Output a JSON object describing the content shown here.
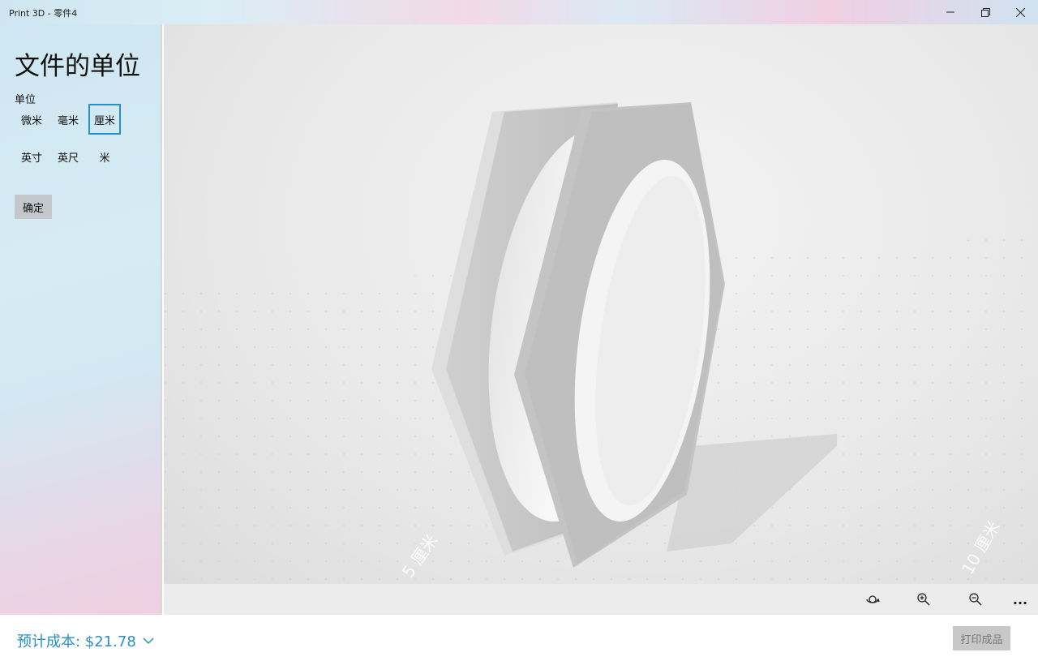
{
  "window": {
    "title": "Print 3D - 零件4",
    "minimize_icon": "minimize-icon",
    "maximize_icon": "restore-icon",
    "close_icon": "close-icon"
  },
  "panel": {
    "title": "文件的单位",
    "unit_label": "单位",
    "units": [
      {
        "label": "微米",
        "selected": false
      },
      {
        "label": "毫米",
        "selected": false
      },
      {
        "label": "厘米",
        "selected": true
      },
      {
        "label": "英寸",
        "selected": false
      },
      {
        "label": "英尺",
        "selected": false
      },
      {
        "label": "米",
        "selected": false
      }
    ],
    "confirm_label": "确定"
  },
  "viewport": {
    "scale_labels": [
      "5 厘米",
      "10 厘米"
    ]
  },
  "toolbar": {
    "icons": [
      "rotate-view-icon",
      "zoom-in-icon",
      "zoom-out-icon",
      "more-icon"
    ],
    "more_label": "..."
  },
  "bottom": {
    "cost_label": "预计成本: $21.78",
    "print_label": "打印成品"
  },
  "colors": {
    "accent": "#2a8fc7"
  }
}
